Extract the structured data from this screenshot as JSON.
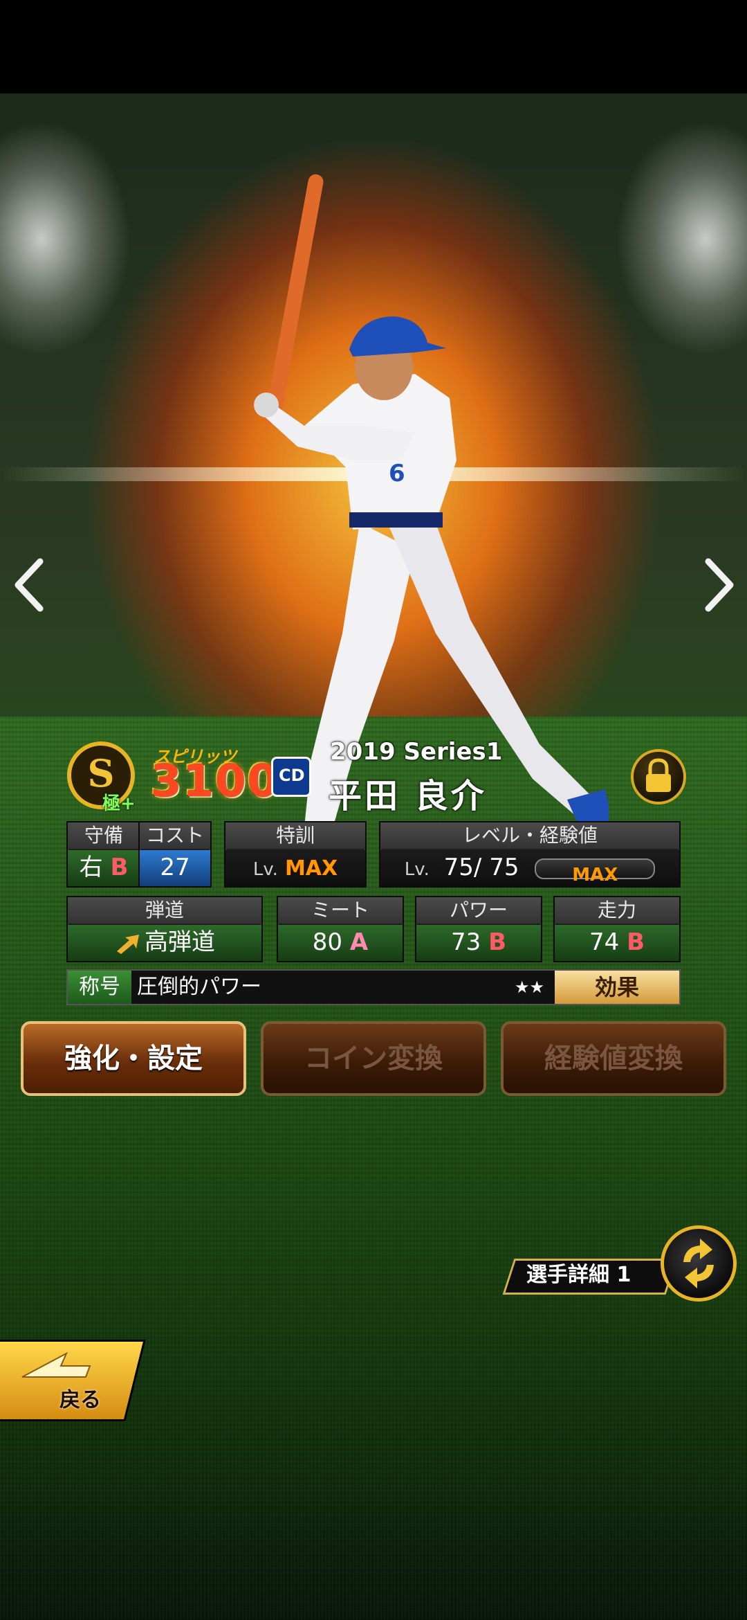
{
  "player": {
    "series": "2019 Series1",
    "name": "平田 良介",
    "team_abbr": "CD",
    "rank_letter": "S",
    "rank_sub": "極+",
    "spirits_label": "スピリッツ",
    "spirits_value": "3100"
  },
  "stats": {
    "defense": {
      "label": "守備",
      "hand": "右",
      "grade": "B"
    },
    "cost": {
      "label": "コスト",
      "value": "27"
    },
    "special_training": {
      "label": "特訓",
      "lv_prefix": "Lv.",
      "value": "MAX"
    },
    "level": {
      "label": "レベル・経験値",
      "lv_prefix": "Lv.",
      "current": "75",
      "max": "75",
      "exp": "MAX"
    },
    "trajectory": {
      "label": "弾道",
      "value": "高弾道"
    },
    "meet": {
      "label": "ミート",
      "value": "80",
      "grade": "A"
    },
    "power": {
      "label": "パワー",
      "value": "73",
      "grade": "B"
    },
    "speed": {
      "label": "走力",
      "value": "74",
      "grade": "B"
    }
  },
  "title": {
    "label": "称号",
    "value": "圧倒的パワー",
    "stars": "★★",
    "effect_button": "効果"
  },
  "actions": {
    "enhance": "強化・設定",
    "coin_convert": "コイン変換",
    "exp_convert": "経験値変換"
  },
  "detail_button": "選手詳細 1",
  "back_button": "戻る",
  "colors": {
    "accent_gold": "#e8b424",
    "grade_b": "#ff5a6a",
    "max_orange": "#ff9a00"
  }
}
